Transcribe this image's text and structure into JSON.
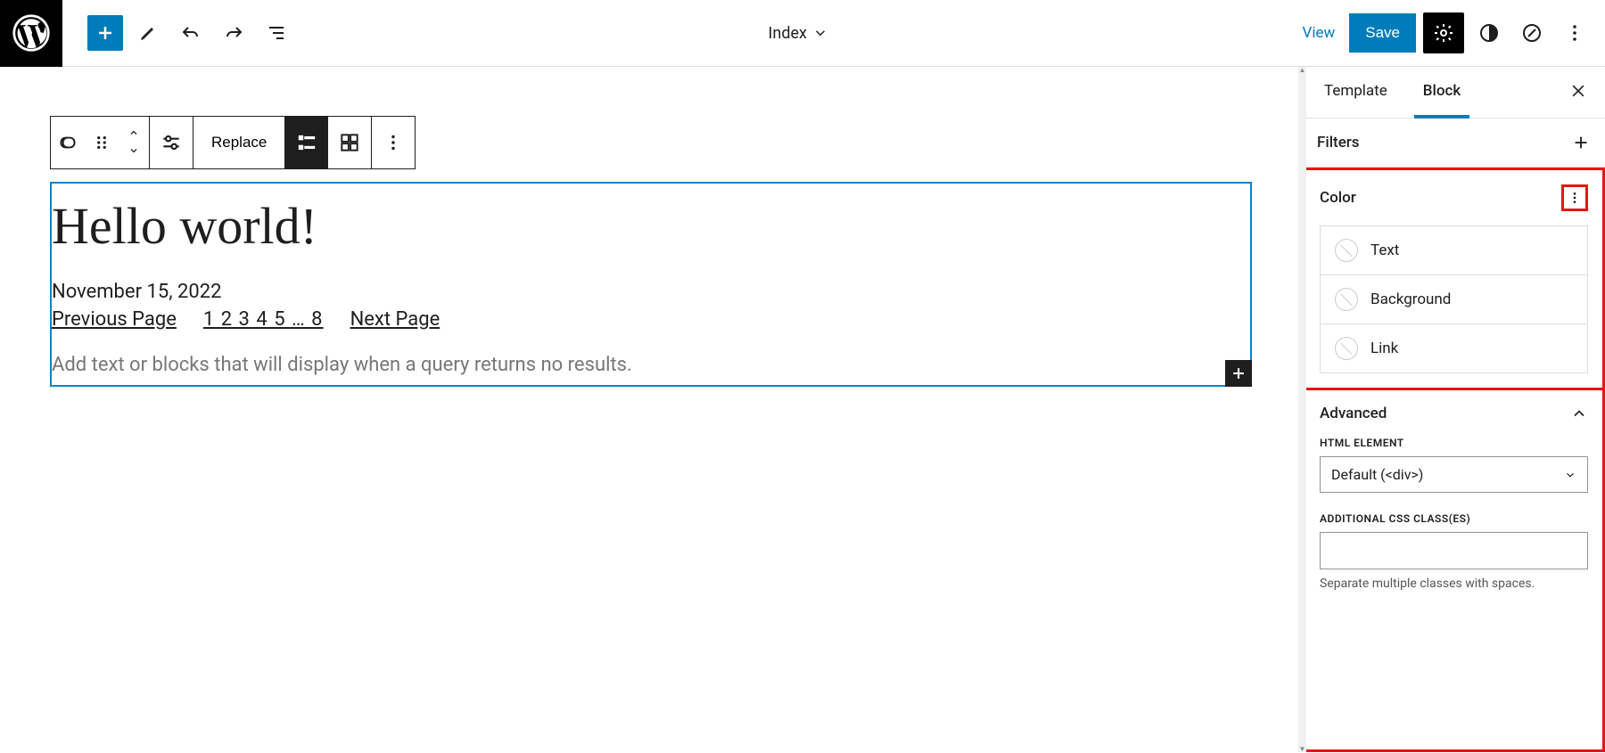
{
  "top": {
    "doc_title": "Index",
    "view_label": "View",
    "save_label": "Save"
  },
  "block_toolbar": {
    "replace_label": "Replace"
  },
  "post": {
    "title": "Hello world!",
    "date": "November 15, 2022",
    "prev": "Previous Page",
    "next": "Next Page",
    "pages": "1 2 3 4 5 … 8",
    "no_results_placeholder": "Add text or blocks that will display when a query returns no results."
  },
  "sidebar": {
    "tab_template": "Template",
    "tab_block": "Block",
    "filters_label": "Filters",
    "color_label": "Color",
    "color_text": "Text",
    "color_bg": "Background",
    "color_link": "Link",
    "advanced_label": "Advanced",
    "html_element_label": "HTML ELEMENT",
    "html_element_value": "Default (<div>)",
    "css_label": "ADDITIONAL CSS CLASS(ES)",
    "css_value": "",
    "css_help": "Separate multiple classes with spaces."
  }
}
